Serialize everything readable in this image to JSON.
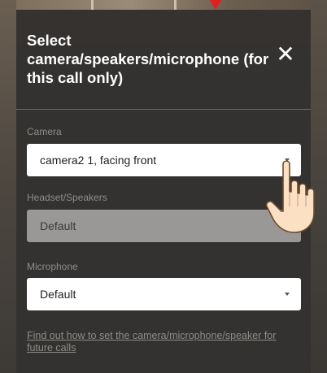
{
  "dialog": {
    "title": "Select camera/speakers/microphone (for this call only)",
    "close_glyph": "✕"
  },
  "camera": {
    "label": "Camera",
    "value": "camera2 1, facing front"
  },
  "speakers": {
    "label": "Headset/Speakers",
    "value": "Default",
    "disabled": true
  },
  "microphone": {
    "label": "Microphone",
    "value": "Default"
  },
  "help_link": "Find out how to set the camera/microphone/speaker for future calls",
  "icons": {
    "close": "close-icon",
    "dropdown": "chevron-down-icon",
    "pointer": "hand-pointer-icon",
    "annotation": "red-arrow-icon"
  },
  "colors": {
    "dialog_bg": "#343230",
    "title_text": "#ffffff",
    "field_label": "#8f8d89",
    "select_bg": "#ffffff",
    "select_disabled_bg": "#9a9896",
    "annotation_arrow": "#e02020"
  }
}
